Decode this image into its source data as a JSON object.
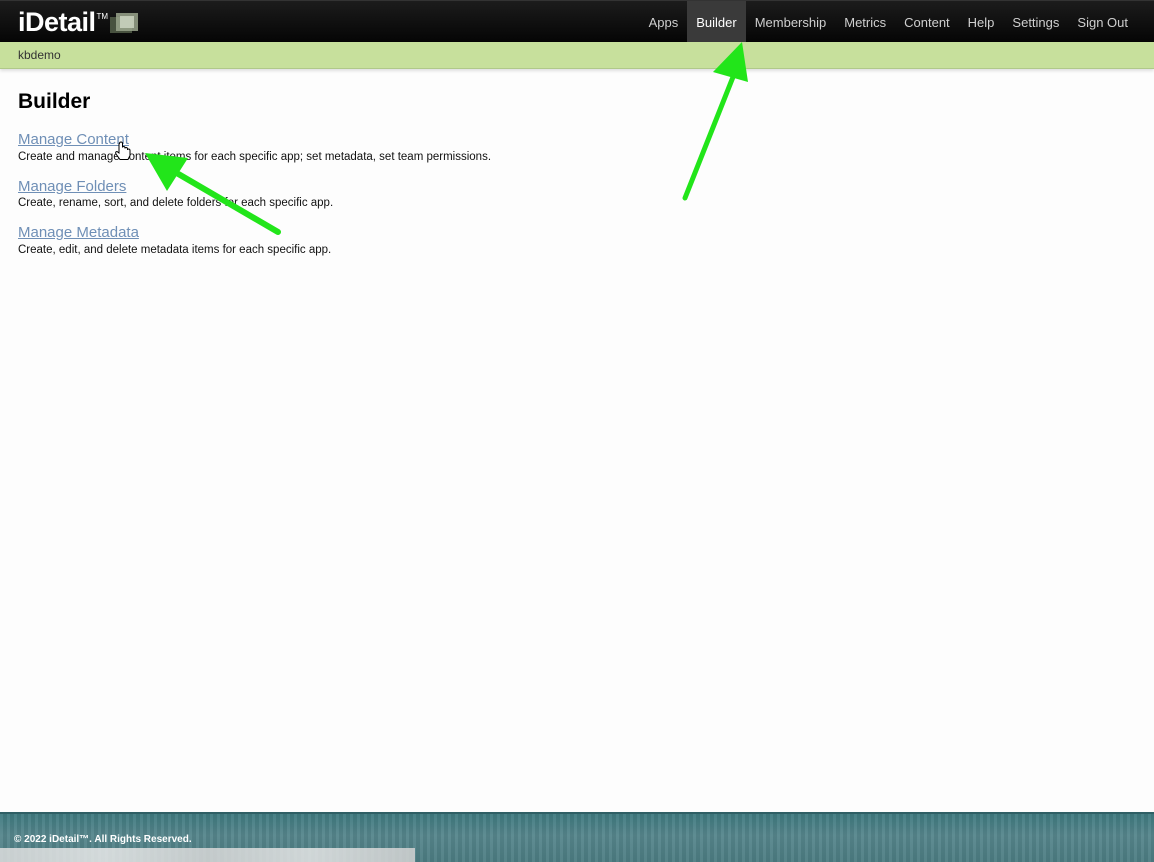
{
  "header": {
    "logo_text": "iDetail",
    "logo_tm": "TM",
    "nav": [
      {
        "label": "Apps"
      },
      {
        "label": "Builder",
        "active": true
      },
      {
        "label": "Membership"
      },
      {
        "label": "Metrics"
      },
      {
        "label": "Content"
      },
      {
        "label": "Help"
      },
      {
        "label": "Settings"
      },
      {
        "label": "Sign Out"
      }
    ]
  },
  "subbar": {
    "user": "kbdemo"
  },
  "main": {
    "title": "Builder",
    "sections": [
      {
        "link": "Manage Content",
        "description": "Create and manage content items for each specific app; set metadata, set team permissions."
      },
      {
        "link": "Manage Folders",
        "description": "Create, rename, sort, and delete folders for each specific app."
      },
      {
        "link": "Manage Metadata",
        "description": "Create, edit, and delete metadata items for each specific app."
      }
    ]
  },
  "footer": {
    "copyright": "© 2022 iDetail™.  All Rights Reserved."
  },
  "colors": {
    "topbar": "#0a0a0a",
    "subbar": "#c7e09c",
    "link": "#6f8fb6",
    "annotation_arrow": "#22e51a",
    "footer": "#4c7c82"
  },
  "icons": [
    "logo-mark-icon",
    "hand-cursor-icon",
    "annotation-arrow"
  ]
}
